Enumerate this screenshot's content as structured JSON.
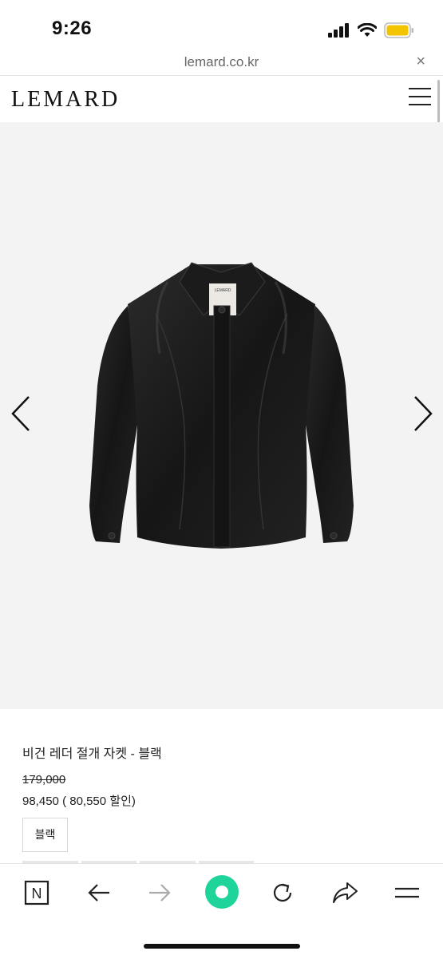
{
  "status_bar": {
    "time": "9:26",
    "battery_color": "#f5c400"
  },
  "browser": {
    "url": "lemard.co.kr",
    "close_icon": "×"
  },
  "site": {
    "logo": "LEMARD"
  },
  "product": {
    "name": "비건 레더 절개 자켓 - 블랙",
    "original_price": "179,000",
    "sale_price": "98,450",
    "discount_text": "( 80,550 할인)",
    "option_label": "블랙",
    "garment_tag": "LEMARD"
  },
  "toolbar": {
    "home_icon_letter": "N",
    "accent_color": "#1ed49a"
  }
}
